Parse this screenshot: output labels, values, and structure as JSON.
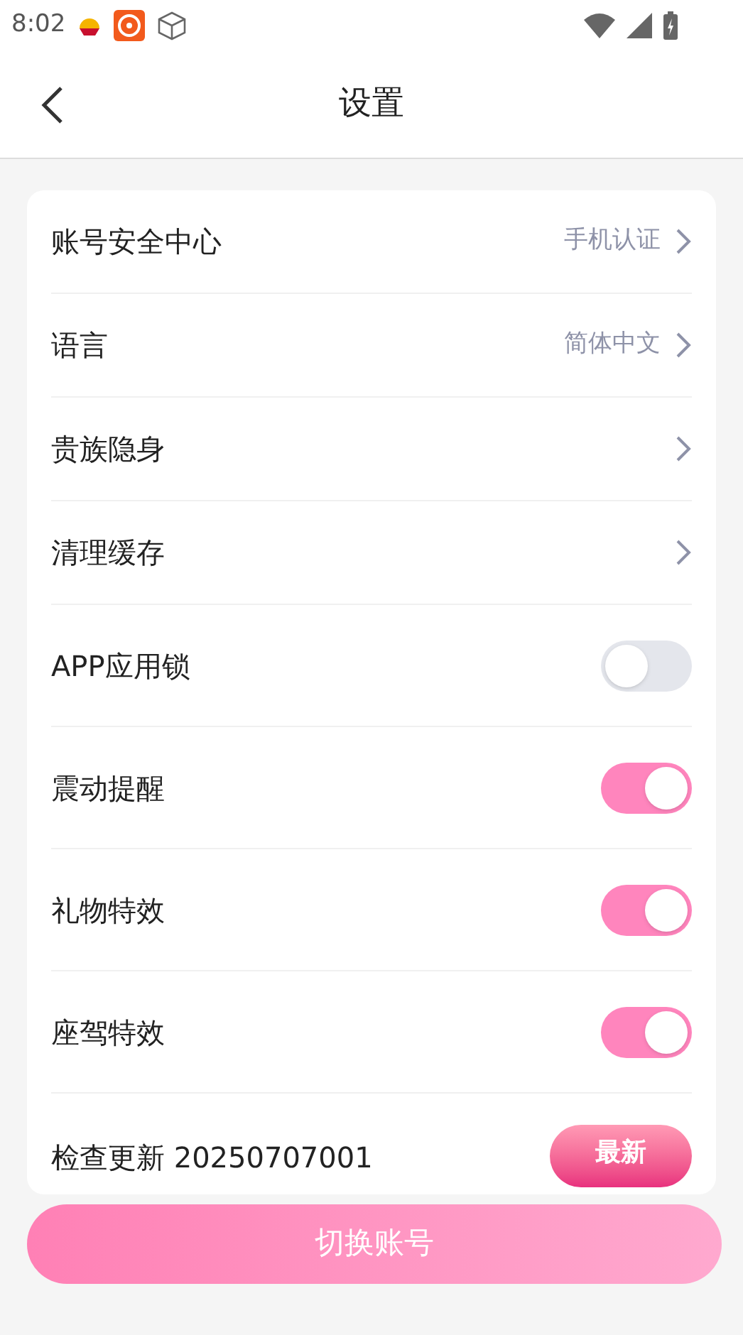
{
  "status_bar": {
    "time": "8:02"
  },
  "header": {
    "title": "设置"
  },
  "settings": [
    {
      "kind": "nav",
      "label": "账号安全中心",
      "value": "手机认证"
    },
    {
      "kind": "nav",
      "label": "语言",
      "value": "简体中文"
    },
    {
      "kind": "nav",
      "label": "贵族隐身"
    },
    {
      "kind": "nav",
      "label": "清理缓存"
    },
    {
      "kind": "toggle",
      "label": "APP应用锁",
      "on": false
    },
    {
      "kind": "toggle",
      "label": "震动提醒",
      "on": true
    },
    {
      "kind": "toggle",
      "label": "礼物特效",
      "on": true
    },
    {
      "kind": "toggle",
      "label": "座驾特效",
      "on": true
    },
    {
      "kind": "update",
      "label": "检查更新 20250707001",
      "badge": "最新"
    }
  ],
  "switch_account_button": "切换账号"
}
